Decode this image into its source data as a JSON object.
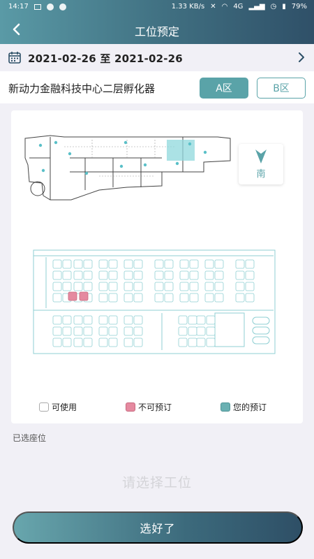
{
  "status_bar": {
    "time": "14:17",
    "net_speed": "1.33 KB/s",
    "network": "4G",
    "battery": "79%"
  },
  "header": {
    "title": "工位预定",
    "back_icon": "chevron-left-icon"
  },
  "date_range": {
    "text": "2021-02-26 至 2021-02-26",
    "icon": "calendar-icon"
  },
  "location": {
    "name": "新动力金融科技中心二层孵化器",
    "zones": [
      "A区",
      "B区"
    ],
    "selected_zone": "A区"
  },
  "compass": {
    "label": "南",
    "icon": "arrow-down-icon"
  },
  "legend": {
    "available": "可使用",
    "unavailable": "不可预订",
    "mine": "您的预订"
  },
  "selection": {
    "label": "已选座位",
    "placeholder": "请选择工位"
  },
  "confirm_button": "选好了",
  "colors": {
    "accent": "#5aa3a8",
    "header_start": "#5a9aa6",
    "header_end": "#2f5068",
    "unavailable": "#e58aa0",
    "mine": "#6ab0b2"
  }
}
